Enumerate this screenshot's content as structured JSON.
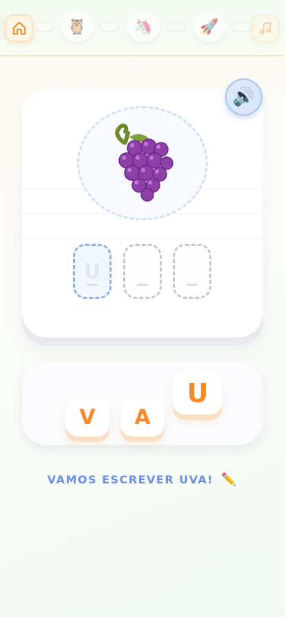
{
  "topbar": {
    "home_icon": "home-icon",
    "music_icon": "music-note-icon",
    "stages": [
      {
        "icon": "owl-icon",
        "glyph": "🦉"
      },
      {
        "icon": "unicorn-icon",
        "glyph": "🦄"
      },
      {
        "icon": "rocket-icon",
        "glyph": "🚀"
      }
    ]
  },
  "card": {
    "sound_icon": "speaker-icon",
    "sound_glyph": "🔊",
    "image_icon": "grapes-icon",
    "slots": [
      {
        "letter": "U",
        "filled": false,
        "active": true
      },
      {
        "letter": "",
        "filled": false,
        "active": false
      },
      {
        "letter": "",
        "filled": false,
        "active": false
      }
    ]
  },
  "tray": {
    "tiles": [
      "V",
      "A",
      "U"
    ]
  },
  "prompt": {
    "text": "VAMOS ESCREVER UVA!",
    "emoji": "✏️"
  },
  "colors": {
    "accent_orange": "#f6892b",
    "accent_blue": "#6b8fe6",
    "slot_active_border": "#8db1ea"
  }
}
